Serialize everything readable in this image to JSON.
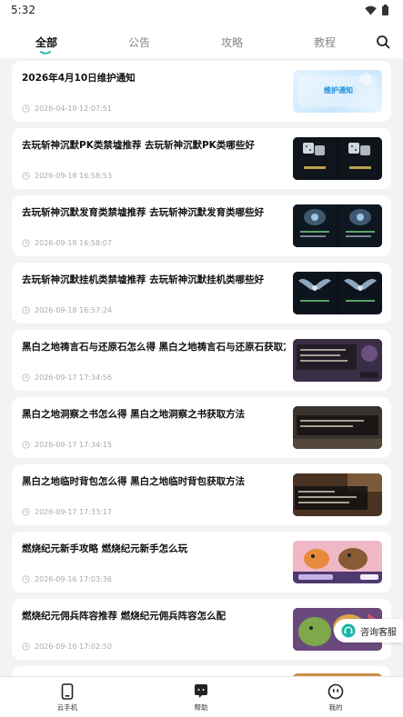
{
  "status_bar": {
    "time": "5:32"
  },
  "tabs": [
    {
      "label": "全部",
      "active": true
    },
    {
      "label": "公告",
      "active": false
    },
    {
      "label": "攻略",
      "active": false
    },
    {
      "label": "教程",
      "active": false
    }
  ],
  "articles": [
    {
      "title": "2026年4月10日维护通知",
      "time": "2026-04-10 12:07:51",
      "thumb_text": "维护通知",
      "thumb_style": "notice"
    },
    {
      "title": "去玩斩神沉默PK类禁墟推荐 去玩斩神沉默PK类哪些好",
      "time": "2026-09-18 16:58:53",
      "thumb_style": "dice"
    },
    {
      "title": "去玩斩神沉默发育类禁墟推荐 去玩斩神沉默发育类哪些好",
      "time": "2026-09-18 16:58:07",
      "thumb_style": "dice"
    },
    {
      "title": "去玩斩神沉默挂机类禁墟推荐 去玩斩神沉默挂机类哪些好",
      "time": "2026-09-18 16:57:24",
      "thumb_style": "wings"
    },
    {
      "title": "黑白之地祷言石与还原石怎么得 黑白之地祷言石与还原石获取方法",
      "time": "2026-09-17 17:34:56",
      "thumb_style": "dialog-purple"
    },
    {
      "title": "黑白之地洞察之书怎么得 黑白之地洞察之书获取方法",
      "time": "2026-09-17 17:34:15",
      "thumb_style": "dialog-dark"
    },
    {
      "title": "黑白之地临时背包怎么得 黑白之地临时背包获取方法",
      "time": "2026-09-17 17:33:17",
      "thumb_style": "dialog-brown"
    },
    {
      "title": "燃烧纪元新手攻略 燃烧纪元新手怎么玩",
      "time": "2026-09-16 17:03:36",
      "thumb_style": "creature-purple"
    },
    {
      "title": "燃烧纪元佣兵阵容推荐 燃烧纪元佣兵阵容怎么配",
      "time": "2026-09-16 17:02:50",
      "thumb_style": "creature-green"
    }
  ],
  "float_chat": {
    "label": "咨询客服",
    "icon": "headset-icon"
  },
  "bottom_nav": [
    {
      "label": "云手机",
      "icon": "phone-icon"
    },
    {
      "label": "帮助",
      "icon": "help-chat-icon"
    },
    {
      "label": "我的",
      "icon": "profile-face-icon"
    }
  ],
  "colors": {
    "accent": "#19b3a8",
    "notice_text": "#1a8fe0"
  }
}
